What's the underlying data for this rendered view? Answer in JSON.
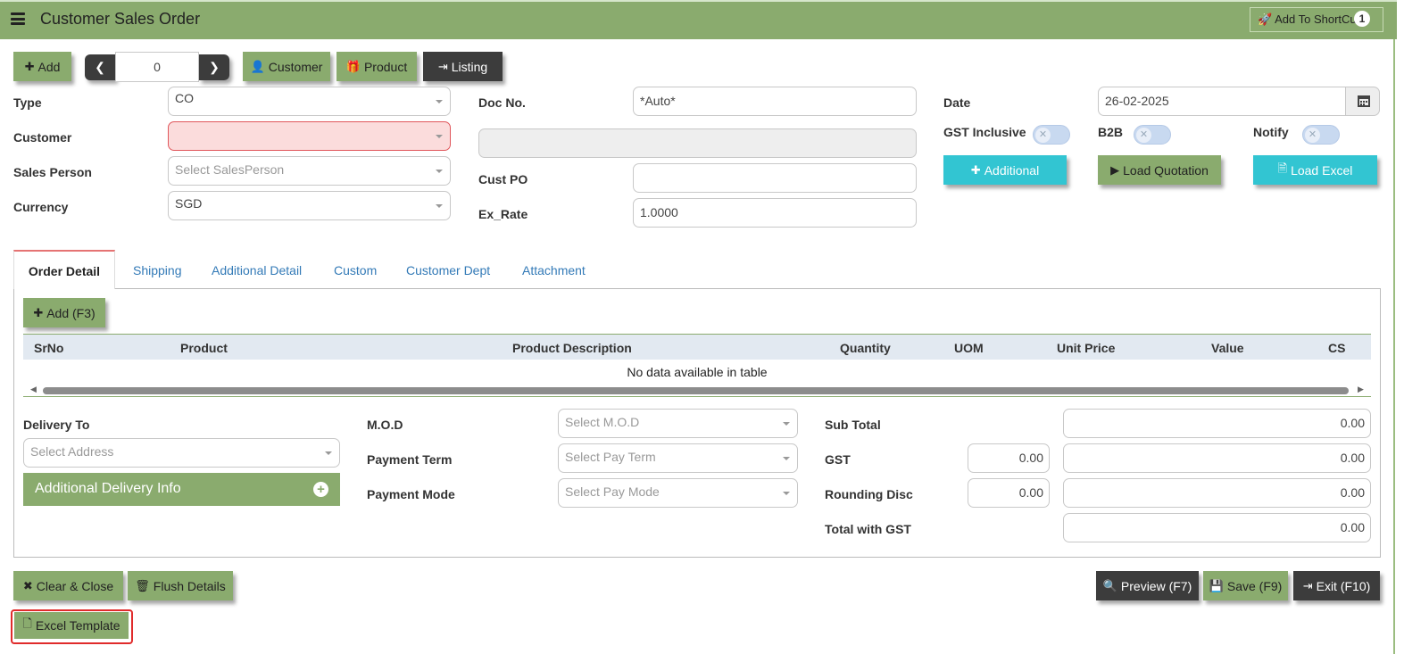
{
  "header": {
    "title": "Customer Sales Order",
    "shortcut_label": "Add To ShortCut",
    "shortcut_badge": "1"
  },
  "toolbar": {
    "add": "Add",
    "nav_value": "0",
    "customer": "Customer",
    "product": "Product",
    "listing": "Listing"
  },
  "form": {
    "type_label": "Type",
    "type_value": "CO",
    "customer_label": "Customer",
    "sales_person_label": "Sales Person",
    "sales_person_placeholder": "Select SalesPerson",
    "currency_label": "Currency",
    "currency_value": "SGD",
    "doc_no_label": "Doc No.",
    "doc_no_value": "*Auto*",
    "cust_po_label": "Cust PO",
    "ex_rate_label": "Ex_Rate",
    "ex_rate_value": "1.0000",
    "date_label": "Date",
    "date_value": "26-02-2025",
    "gst_inclusive_label": "GST Inclusive",
    "b2b_label": "B2B",
    "notify_label": "Notify",
    "additional_btn": "Additional",
    "load_quotation_btn": "Load Quotation",
    "load_excel_btn": "Load Excel"
  },
  "tabs": [
    "Order Detail",
    "Shipping",
    "Additional Detail",
    "Custom",
    "Customer Dept",
    "Attachment"
  ],
  "detail": {
    "add_btn": "Add (F3)",
    "columns": [
      "SrNo",
      "Product",
      "Product Description",
      "Quantity",
      "UOM",
      "Unit Price",
      "Value",
      "CS"
    ],
    "empty_message": "No data available in table"
  },
  "delivery": {
    "label": "Delivery To",
    "address_placeholder": "Select Address",
    "additional_info": "Additional Delivery Info"
  },
  "payment": {
    "mod_label": "M.O.D",
    "mod_placeholder": "Select M.O.D",
    "term_label": "Payment Term",
    "term_placeholder": "Select Pay Term",
    "mode_label": "Payment Mode",
    "mode_placeholder": "Select Pay Mode"
  },
  "totals": {
    "sub_total_label": "Sub Total",
    "sub_total": "0.00",
    "gst_label": "GST",
    "gst_rate": "0.00",
    "gst_value": "0.00",
    "rounding_label": "Rounding Disc",
    "rounding_rate": "0.00",
    "rounding_value": "0.00",
    "total_label": "Total with GST",
    "total_value": "0.00"
  },
  "footer": {
    "clear_close": "Clear & Close",
    "flush_details": "Flush Details",
    "excel_template": "Excel Template",
    "preview": "Preview (F7)",
    "save": "Save (F9)",
    "exit": "Exit (F10)"
  },
  "colors": {
    "accent": "#8aab6e",
    "dark": "#3c3c3c",
    "cyan": "#32c5d2",
    "error": "#e0565b"
  }
}
